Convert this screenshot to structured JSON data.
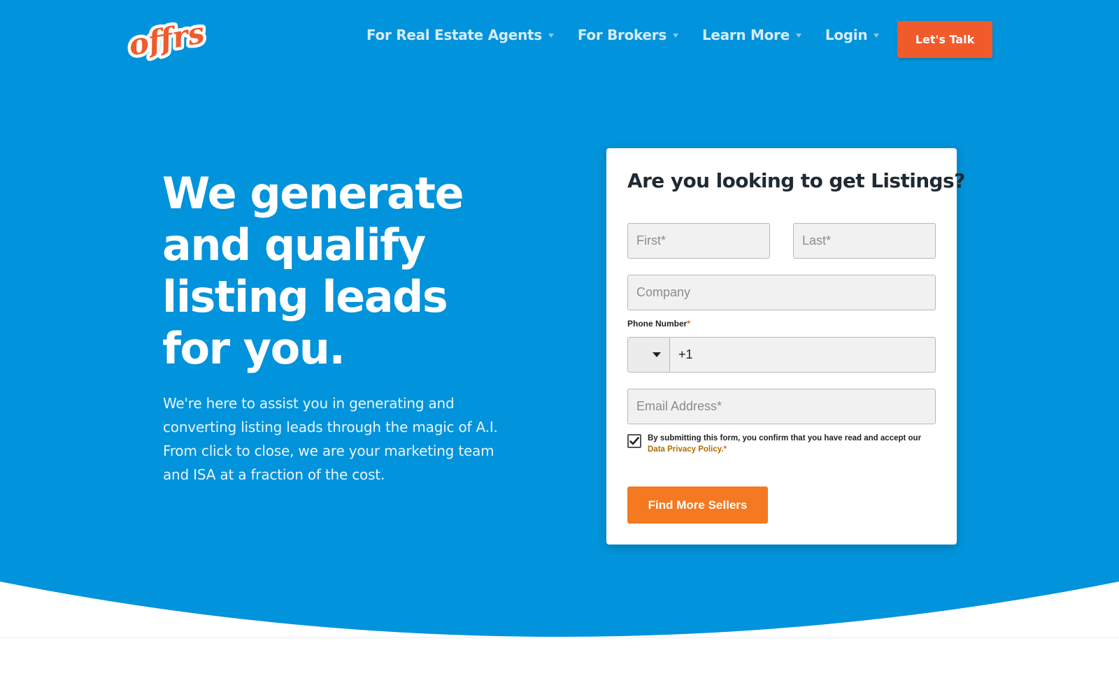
{
  "brand": {
    "logo_text": "offrs",
    "colors": {
      "hero_blue": "#0193db",
      "accent_orange": "#f15a2b",
      "button_orange": "#f47921",
      "link_gold": "#b36b00"
    }
  },
  "nav": {
    "items": [
      {
        "label": "For Real Estate Agents",
        "icon": "caret-down-icon"
      },
      {
        "label": "For Brokers",
        "icon": "caret-down-icon"
      },
      {
        "label": "Learn More",
        "icon": "caret-down-icon"
      },
      {
        "label": "Login",
        "icon": "caret-down-icon"
      }
    ],
    "cta_label": "Let's Talk"
  },
  "hero": {
    "headline_lines": [
      "We generate",
      "and qualify",
      "listing leads",
      "for you."
    ],
    "subcopy_lines": [
      "We're here to assist you in generating and",
      "converting listing leads through the magic of A.I.",
      "From click to close, we are your marketing team",
      "and ISA at a fraction of the cost."
    ]
  },
  "form": {
    "title": "Are you looking to get Listings?",
    "first_placeholder": "First*",
    "last_placeholder": "Last*",
    "company_placeholder": "Company",
    "phone_label": "Phone Number",
    "phone_required_mark": "*",
    "phone_value": "+1",
    "country_icon": "caret-down-icon",
    "email_placeholder": "Email Address*",
    "consent_checked": true,
    "consent_text": "By submitting this form, you confirm that you have read and accept our ",
    "consent_link": "Data Privacy Policy.",
    "consent_required_mark": "*",
    "submit_label": "Find More Sellers"
  }
}
